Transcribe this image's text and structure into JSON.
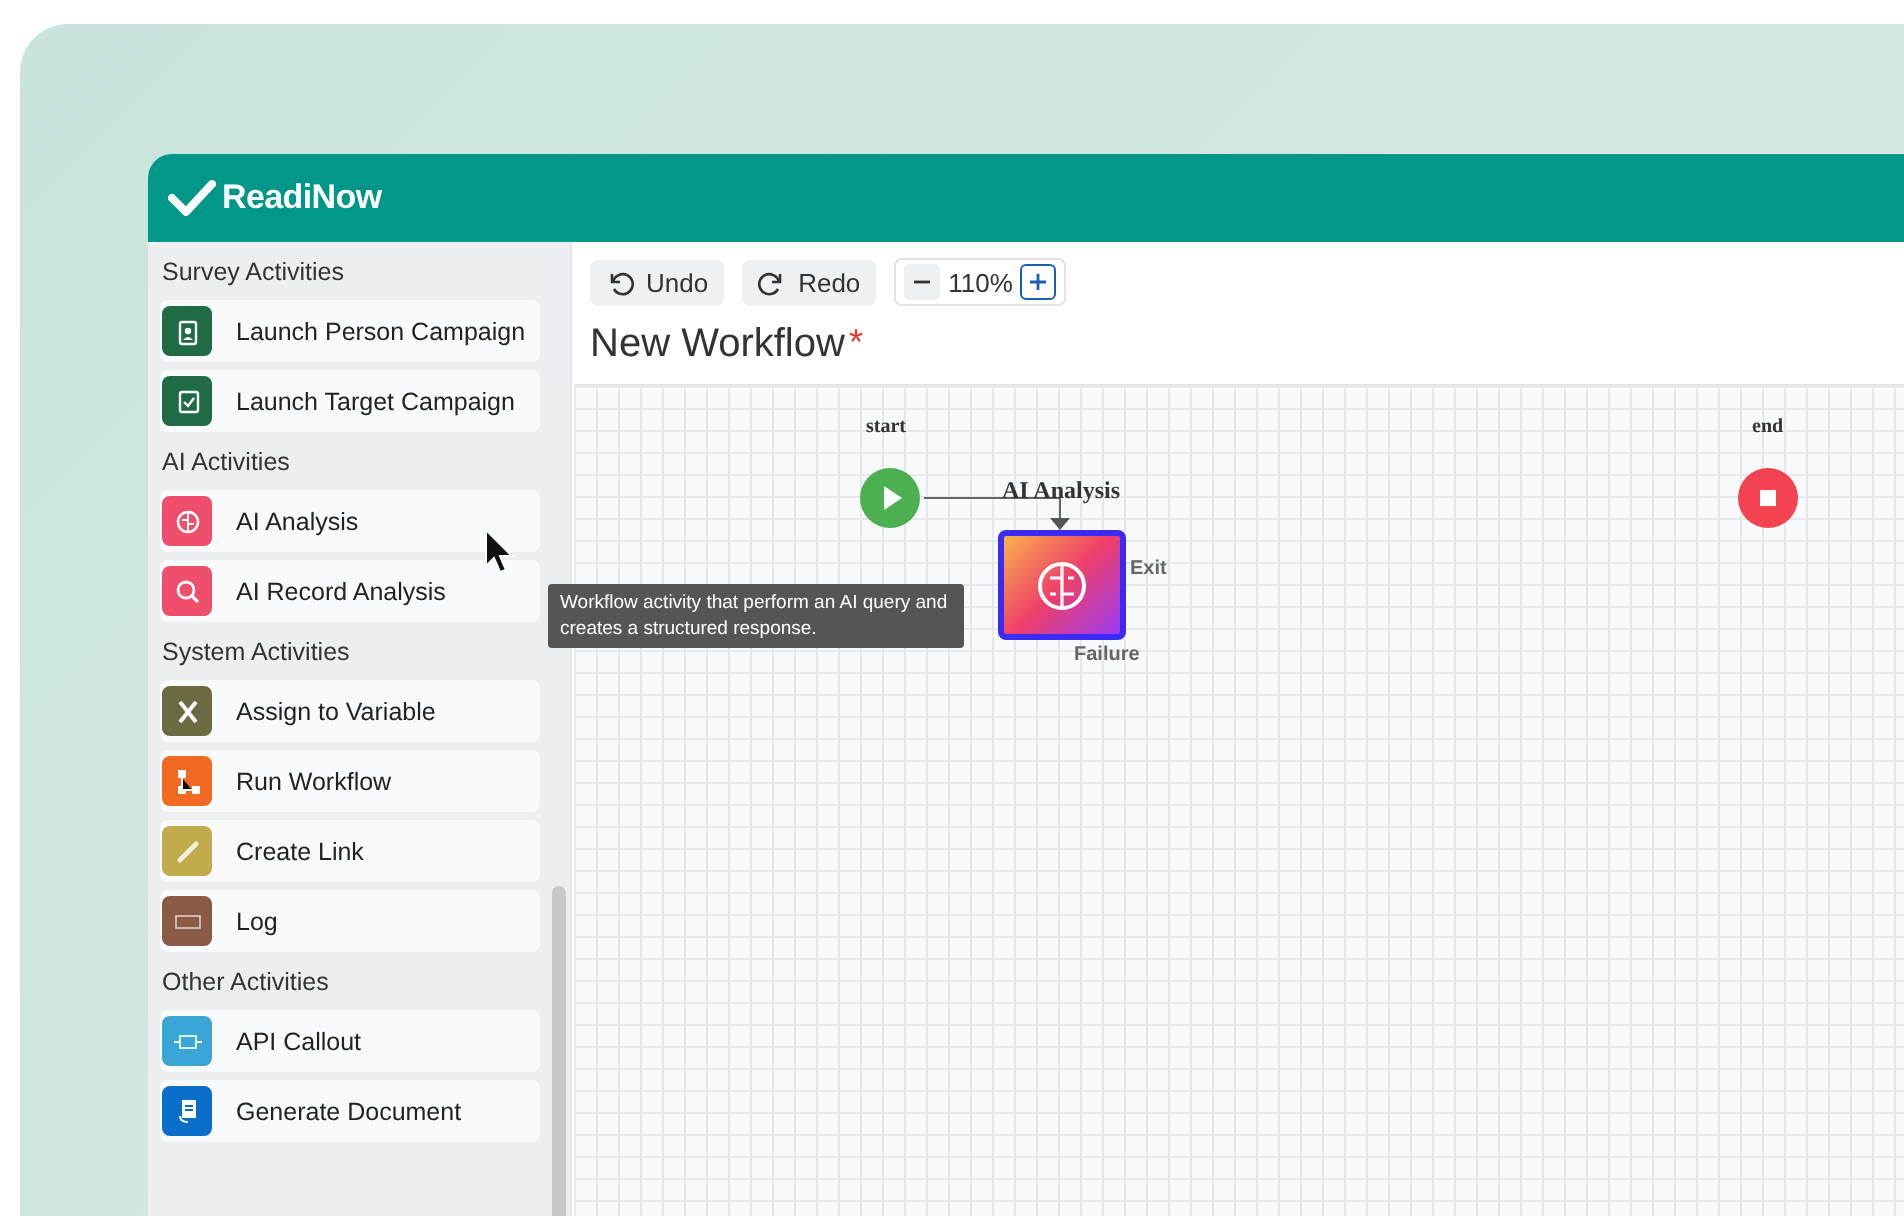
{
  "header": {
    "logo": "ReadiNow"
  },
  "sidebar": {
    "sections": [
      {
        "title": "Survey Activities",
        "items": [
          {
            "label": "Launch Person Campaign",
            "color": "#1e6b46"
          },
          {
            "label": "Launch Target Campaign",
            "color": "#1e6b46"
          }
        ]
      },
      {
        "title": "AI Activities",
        "items": [
          {
            "label": "AI Analysis",
            "color": "#ef4f6a"
          },
          {
            "label": "AI Record Analysis",
            "color": "#ef4f6a"
          }
        ]
      },
      {
        "title": "System Activities",
        "items": [
          {
            "label": "Assign to Variable",
            "color": "#6b6a40"
          },
          {
            "label": "Run Workflow",
            "color": "#f26a21"
          },
          {
            "label": "Create Link",
            "color": "#c2ab4a"
          },
          {
            "label": "Log",
            "color": "#8b5a44"
          }
        ]
      },
      {
        "title": "Other Activities",
        "items": [
          {
            "label": "API Callout",
            "color": "#3aa6d6"
          },
          {
            "label": "Generate Document",
            "color": "#0a6fc9"
          }
        ]
      }
    ]
  },
  "toolbar": {
    "undo": "Undo",
    "redo": "Redo",
    "zoom": "110%"
  },
  "workflow": {
    "title": "New Workflow",
    "unsaved_mark": "*"
  },
  "canvas": {
    "start_label": "start",
    "end_label": "end",
    "node": {
      "label": "AI Analysis",
      "selected": true,
      "exit": "Exit",
      "failure": "Failure"
    }
  },
  "tooltip": "Workflow activity that perform an AI query and creates a structured response."
}
